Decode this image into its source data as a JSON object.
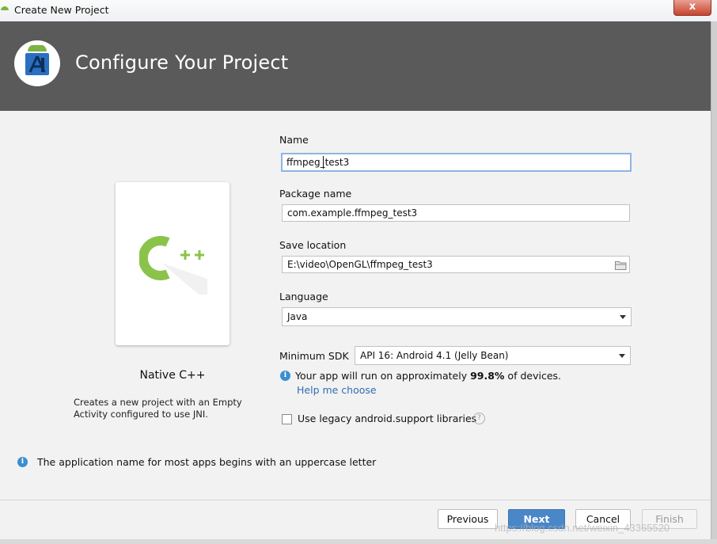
{
  "window": {
    "title": "Create New Project",
    "close_glyph": "x"
  },
  "header": {
    "title": "Configure Your Project",
    "logo_icon": "android-studio-icon"
  },
  "template": {
    "icon": "cpp-icon",
    "name": "Native C++",
    "description": "Creates a new project with an Empty Activity configured to use JNI."
  },
  "form": {
    "name_label": "Name",
    "name_value": "ffmpeg_test3",
    "package_label": "Package name",
    "package_value": "com.example.ffmpeg_test3",
    "location_label": "Save location",
    "location_value": "E:\\video\\OpenGL\\ffmpeg_test3",
    "language_label": "Language",
    "language_value": "Java",
    "min_sdk_label": "Minimum SDK",
    "min_sdk_value": "API 16: Android 4.1 (Jelly Bean)",
    "sdk_note_prefix": "Your app will run on approximately ",
    "sdk_note_percent": "99.8%",
    "sdk_note_suffix": " of devices.",
    "help_link": "Help me choose",
    "legacy_label": "Use legacy android.support libraries",
    "legacy_checked": false
  },
  "bottom_info": "The application name for most apps begins with an uppercase letter",
  "buttons": {
    "previous": "Previous",
    "next": "Next",
    "cancel": "Cancel",
    "finish": "Finish"
  },
  "watermark": "https://blog.csdn.net/weixin_43365520",
  "colors": {
    "banner": "#5a5a5a",
    "primary_button": "#4a87c8",
    "info_icon": "#3b8fd0",
    "link": "#2f6db3",
    "cpp_green": "#8bc34a"
  }
}
